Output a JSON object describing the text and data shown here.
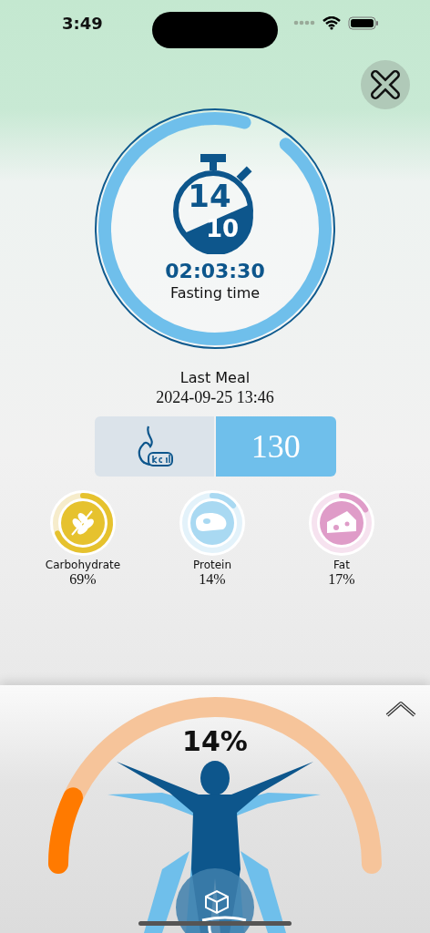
{
  "status_bar": {
    "time": "3:49"
  },
  "fasting": {
    "start_hours": "14",
    "end_hours": "10",
    "elapsed": "02:03:30",
    "label": "Fasting time"
  },
  "last_meal": {
    "title": "Last Meal",
    "datetime": "2024-09-25 13:46",
    "kcal": "130"
  },
  "macros": [
    {
      "kind": "carb",
      "name": "Carbohydrate",
      "percent": "69%",
      "color": "#e6c22e"
    },
    {
      "kind": "protein",
      "name": "Protein",
      "percent": "14%",
      "color": "#a9d9f2"
    },
    {
      "kind": "fat",
      "name": "Fat",
      "percent": "17%",
      "color": "#df9cc8"
    }
  ],
  "body_panel": {
    "percent": "14%",
    "expanded": false
  }
}
